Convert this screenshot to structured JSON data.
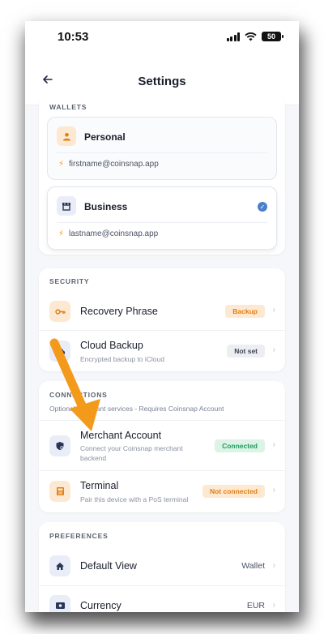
{
  "status": {
    "time": "10:53",
    "battery": "50"
  },
  "nav": {
    "title": "Settings",
    "back_icon": "arrow-left-icon"
  },
  "wallets": {
    "label": "WALLETS",
    "items": [
      {
        "name": "Personal",
        "email": "firstname@coinsnap.app",
        "icon": "user-icon",
        "selected": false
      },
      {
        "name": "Business",
        "email": "lastname@coinsnap.app",
        "icon": "store-icon",
        "selected": true
      }
    ]
  },
  "security": {
    "label": "SECURITY",
    "items": [
      {
        "title": "Recovery Phrase",
        "subtitle": "",
        "badge": "Backup",
        "icon": "key-icon"
      },
      {
        "title": "Cloud Backup",
        "subtitle": "Encrypted backup to iCloud",
        "badge": "Not set",
        "icon": "cloud-icon"
      }
    ]
  },
  "connections": {
    "label": "CONNECTIONS",
    "subtitle": "Optional merchant services - Requires Coinsnap Account",
    "items": [
      {
        "title": "Merchant Account",
        "subtitle_line1": "Connect your Coinsnap merchant",
        "subtitle_line2": "backend",
        "badge": "Connected",
        "icon": "shield-icon"
      },
      {
        "title": "Terminal",
        "subtitle": "Pair this device with a PoS terminal",
        "badge": "Not connected",
        "icon": "terminal-icon"
      }
    ]
  },
  "preferences": {
    "label": "PREFERENCES",
    "items": [
      {
        "title": "Default View",
        "value": "Wallet",
        "icon": "home-icon"
      },
      {
        "title": "Currency",
        "value": "EUR",
        "icon": "currency-icon"
      }
    ]
  },
  "colors": {
    "accent": "#4a7fcb",
    "backup_bg": "#fde9d2",
    "backup_text": "#e07f12",
    "connected_bg": "#dcf3e6",
    "connected_text": "#1f9d5a",
    "notset_bg": "#eceef2",
    "annotation_arrow": "#f39a1b"
  }
}
